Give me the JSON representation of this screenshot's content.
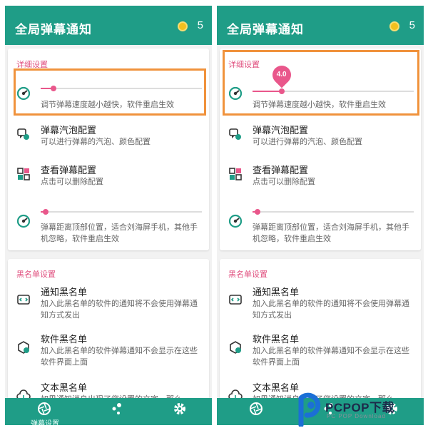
{
  "app": {
    "title": "全局弹幕通知",
    "coins": "5"
  },
  "settings": {
    "section_title": "详细设置",
    "speed": {
      "desc": "调节弹幕速度越小越快，软件重启生效",
      "value": "4.0"
    },
    "bubble": {
      "title": "弹幕汽泡配置",
      "desc": "可以进行弹幕的汽泡、颜色配置"
    },
    "view": {
      "title": "查看弹幕配置",
      "desc": "点击可以删除配置"
    },
    "position": {
      "desc": "弹幕距离顶部位置，适合刘海屏手机，其他手机忽略，软件重启生效"
    }
  },
  "blacklist": {
    "section_title": "黑名单设置",
    "notify": {
      "title": "通知黑名单",
      "desc": "加入此黑名单的软件的通知将不会使用弹幕通知方式发出"
    },
    "app": {
      "title": "软件黑名单",
      "desc": "加入此黑名单的软件弹幕通知不会显示在这些软件界面上面"
    },
    "text": {
      "title": "文本黑名单",
      "desc": "如果通知消息出现了您设置的文字，那么"
    }
  },
  "nav": {
    "danmaku_label": "弹幕设置"
  },
  "sliders": {
    "left_speed": 0.08,
    "right_speed": 0.18,
    "position": 0.03
  },
  "watermark": {
    "text": "PCPOP下载",
    "sub": "PC POP Download"
  },
  "colors": {
    "primary": "#1f9d87",
    "accent": "#e9578b",
    "highlight": "#f0923c"
  }
}
